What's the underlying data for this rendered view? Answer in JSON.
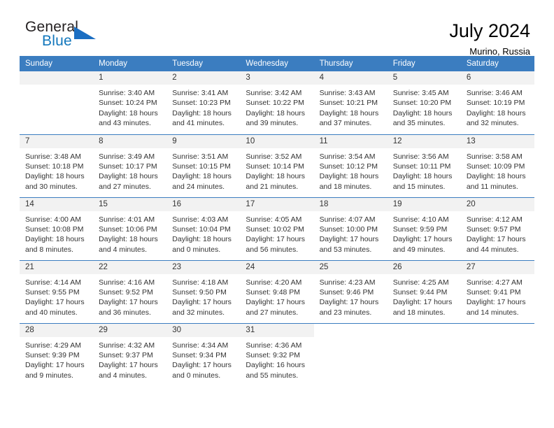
{
  "brand": {
    "name_part1": "General",
    "name_part2": "Blue",
    "triangle_icon": "triangle-icon"
  },
  "header": {
    "title": "July 2024",
    "subtitle": "Murino, Russia"
  },
  "colors": {
    "header_blue": "#3b7dc0",
    "brand_blue": "#1277bc",
    "daynum_band": "#f2f2f2",
    "text": "#333333"
  },
  "weekdays": [
    "Sunday",
    "Monday",
    "Tuesday",
    "Wednesday",
    "Thursday",
    "Friday",
    "Saturday"
  ],
  "labels": {
    "sunrise_prefix": "Sunrise:",
    "sunset_prefix": "Sunset:",
    "daylight_prefix": "Daylight:"
  },
  "weeks": [
    [
      {
        "day": "",
        "empty": true,
        "l1": "",
        "l2": "",
        "l3": "",
        "l4": ""
      },
      {
        "day": "1",
        "l1": "Sunrise: 3:40 AM",
        "l2": "Sunset: 10:24 PM",
        "l3": "Daylight: 18 hours",
        "l4": "and 43 minutes."
      },
      {
        "day": "2",
        "l1": "Sunrise: 3:41 AM",
        "l2": "Sunset: 10:23 PM",
        "l3": "Daylight: 18 hours",
        "l4": "and 41 minutes."
      },
      {
        "day": "3",
        "l1": "Sunrise: 3:42 AM",
        "l2": "Sunset: 10:22 PM",
        "l3": "Daylight: 18 hours",
        "l4": "and 39 minutes."
      },
      {
        "day": "4",
        "l1": "Sunrise: 3:43 AM",
        "l2": "Sunset: 10:21 PM",
        "l3": "Daylight: 18 hours",
        "l4": "and 37 minutes."
      },
      {
        "day": "5",
        "l1": "Sunrise: 3:45 AM",
        "l2": "Sunset: 10:20 PM",
        "l3": "Daylight: 18 hours",
        "l4": "and 35 minutes."
      },
      {
        "day": "6",
        "l1": "Sunrise: 3:46 AM",
        "l2": "Sunset: 10:19 PM",
        "l3": "Daylight: 18 hours",
        "l4": "and 32 minutes."
      }
    ],
    [
      {
        "day": "7",
        "l1": "Sunrise: 3:48 AM",
        "l2": "Sunset: 10:18 PM",
        "l3": "Daylight: 18 hours",
        "l4": "and 30 minutes."
      },
      {
        "day": "8",
        "l1": "Sunrise: 3:49 AM",
        "l2": "Sunset: 10:17 PM",
        "l3": "Daylight: 18 hours",
        "l4": "and 27 minutes."
      },
      {
        "day": "9",
        "l1": "Sunrise: 3:51 AM",
        "l2": "Sunset: 10:15 PM",
        "l3": "Daylight: 18 hours",
        "l4": "and 24 minutes."
      },
      {
        "day": "10",
        "l1": "Sunrise: 3:52 AM",
        "l2": "Sunset: 10:14 PM",
        "l3": "Daylight: 18 hours",
        "l4": "and 21 minutes."
      },
      {
        "day": "11",
        "l1": "Sunrise: 3:54 AM",
        "l2": "Sunset: 10:12 PM",
        "l3": "Daylight: 18 hours",
        "l4": "and 18 minutes."
      },
      {
        "day": "12",
        "l1": "Sunrise: 3:56 AM",
        "l2": "Sunset: 10:11 PM",
        "l3": "Daylight: 18 hours",
        "l4": "and 15 minutes."
      },
      {
        "day": "13",
        "l1": "Sunrise: 3:58 AM",
        "l2": "Sunset: 10:09 PM",
        "l3": "Daylight: 18 hours",
        "l4": "and 11 minutes."
      }
    ],
    [
      {
        "day": "14",
        "l1": "Sunrise: 4:00 AM",
        "l2": "Sunset: 10:08 PM",
        "l3": "Daylight: 18 hours",
        "l4": "and 8 minutes."
      },
      {
        "day": "15",
        "l1": "Sunrise: 4:01 AM",
        "l2": "Sunset: 10:06 PM",
        "l3": "Daylight: 18 hours",
        "l4": "and 4 minutes."
      },
      {
        "day": "16",
        "l1": "Sunrise: 4:03 AM",
        "l2": "Sunset: 10:04 PM",
        "l3": "Daylight: 18 hours",
        "l4": "and 0 minutes."
      },
      {
        "day": "17",
        "l1": "Sunrise: 4:05 AM",
        "l2": "Sunset: 10:02 PM",
        "l3": "Daylight: 17 hours",
        "l4": "and 56 minutes."
      },
      {
        "day": "18",
        "l1": "Sunrise: 4:07 AM",
        "l2": "Sunset: 10:00 PM",
        "l3": "Daylight: 17 hours",
        "l4": "and 53 minutes."
      },
      {
        "day": "19",
        "l1": "Sunrise: 4:10 AM",
        "l2": "Sunset: 9:59 PM",
        "l3": "Daylight: 17 hours",
        "l4": "and 49 minutes."
      },
      {
        "day": "20",
        "l1": "Sunrise: 4:12 AM",
        "l2": "Sunset: 9:57 PM",
        "l3": "Daylight: 17 hours",
        "l4": "and 44 minutes."
      }
    ],
    [
      {
        "day": "21",
        "l1": "Sunrise: 4:14 AM",
        "l2": "Sunset: 9:55 PM",
        "l3": "Daylight: 17 hours",
        "l4": "and 40 minutes."
      },
      {
        "day": "22",
        "l1": "Sunrise: 4:16 AM",
        "l2": "Sunset: 9:52 PM",
        "l3": "Daylight: 17 hours",
        "l4": "and 36 minutes."
      },
      {
        "day": "23",
        "l1": "Sunrise: 4:18 AM",
        "l2": "Sunset: 9:50 PM",
        "l3": "Daylight: 17 hours",
        "l4": "and 32 minutes."
      },
      {
        "day": "24",
        "l1": "Sunrise: 4:20 AM",
        "l2": "Sunset: 9:48 PM",
        "l3": "Daylight: 17 hours",
        "l4": "and 27 minutes."
      },
      {
        "day": "25",
        "l1": "Sunrise: 4:23 AM",
        "l2": "Sunset: 9:46 PM",
        "l3": "Daylight: 17 hours",
        "l4": "and 23 minutes."
      },
      {
        "day": "26",
        "l1": "Sunrise: 4:25 AM",
        "l2": "Sunset: 9:44 PM",
        "l3": "Daylight: 17 hours",
        "l4": "and 18 minutes."
      },
      {
        "day": "27",
        "l1": "Sunrise: 4:27 AM",
        "l2": "Sunset: 9:41 PM",
        "l3": "Daylight: 17 hours",
        "l4": "and 14 minutes."
      }
    ],
    [
      {
        "day": "28",
        "l1": "Sunrise: 4:29 AM",
        "l2": "Sunset: 9:39 PM",
        "l3": "Daylight: 17 hours",
        "l4": "and 9 minutes."
      },
      {
        "day": "29",
        "l1": "Sunrise: 4:32 AM",
        "l2": "Sunset: 9:37 PM",
        "l3": "Daylight: 17 hours",
        "l4": "and 4 minutes."
      },
      {
        "day": "30",
        "l1": "Sunrise: 4:34 AM",
        "l2": "Sunset: 9:34 PM",
        "l3": "Daylight: 17 hours",
        "l4": "and 0 minutes."
      },
      {
        "day": "31",
        "l1": "Sunrise: 4:36 AM",
        "l2": "Sunset: 9:32 PM",
        "l3": "Daylight: 16 hours",
        "l4": "and 55 minutes."
      },
      {
        "day": "",
        "empty": true,
        "blank": true,
        "l1": "",
        "l2": "",
        "l3": "",
        "l4": ""
      },
      {
        "day": "",
        "empty": true,
        "blank": true,
        "l1": "",
        "l2": "",
        "l3": "",
        "l4": ""
      },
      {
        "day": "",
        "empty": true,
        "blank": true,
        "l1": "",
        "l2": "",
        "l3": "",
        "l4": ""
      }
    ]
  ]
}
